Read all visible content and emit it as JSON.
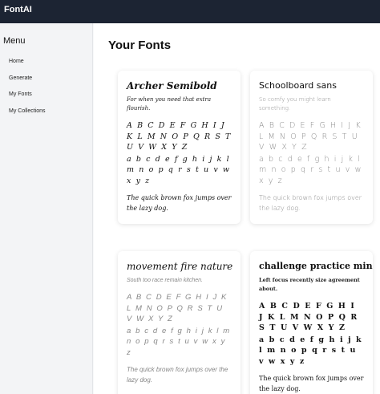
{
  "app": {
    "title": "FontAI"
  },
  "sidebar": {
    "menu_title": "Menu",
    "items": [
      {
        "label": "Home"
      },
      {
        "label": "Generate"
      },
      {
        "label": "My Fonts"
      },
      {
        "label": "My Collections"
      }
    ]
  },
  "main": {
    "title": "Your Fonts",
    "fonts": [
      {
        "name": "Archer Semibold",
        "description": "For when you need that extra flourish.",
        "uppercase": "A B C D E F G H I J K L M N O P Q R S T U V W X Y Z",
        "lowercase": "a b c d e f g h i j k l m n o p q r s t u v w x y z",
        "pangram": "The quick brown fox jumps over the lazy dog."
      },
      {
        "name": "Schoolboard sans",
        "description": "So comfy you might learn something.",
        "uppercase": "A B C D E F G H I J K L M N O P Q R S T U V W X Y Z",
        "lowercase": "a b c d e f g h i j k l m n o p q r s t u v w x y z",
        "pangram": "The quick brown fox jumps over the lazy dog."
      },
      {
        "name": "movement fire nature",
        "description": "South too race remain kitchen.",
        "uppercase": "A B C D E F G H I J K L M N O P Q R S T U V W X Y Z",
        "lowercase": "a b c d e f g h i j k l m n o p q r s t u v w x y z",
        "pangram": "The quick brown fox jumps over the lazy dog."
      },
      {
        "name": "challenge practice mind",
        "description": "Left focus recently size agreement about.",
        "uppercase": "A B C D E F G H I J K L M N O P Q R S T U V W X Y Z",
        "lowercase": "a b c d e f g h i j k l m n o p q r s t u v w x y z",
        "pangram": "The quick brown fox jumps over the lazy dog."
      }
    ]
  }
}
